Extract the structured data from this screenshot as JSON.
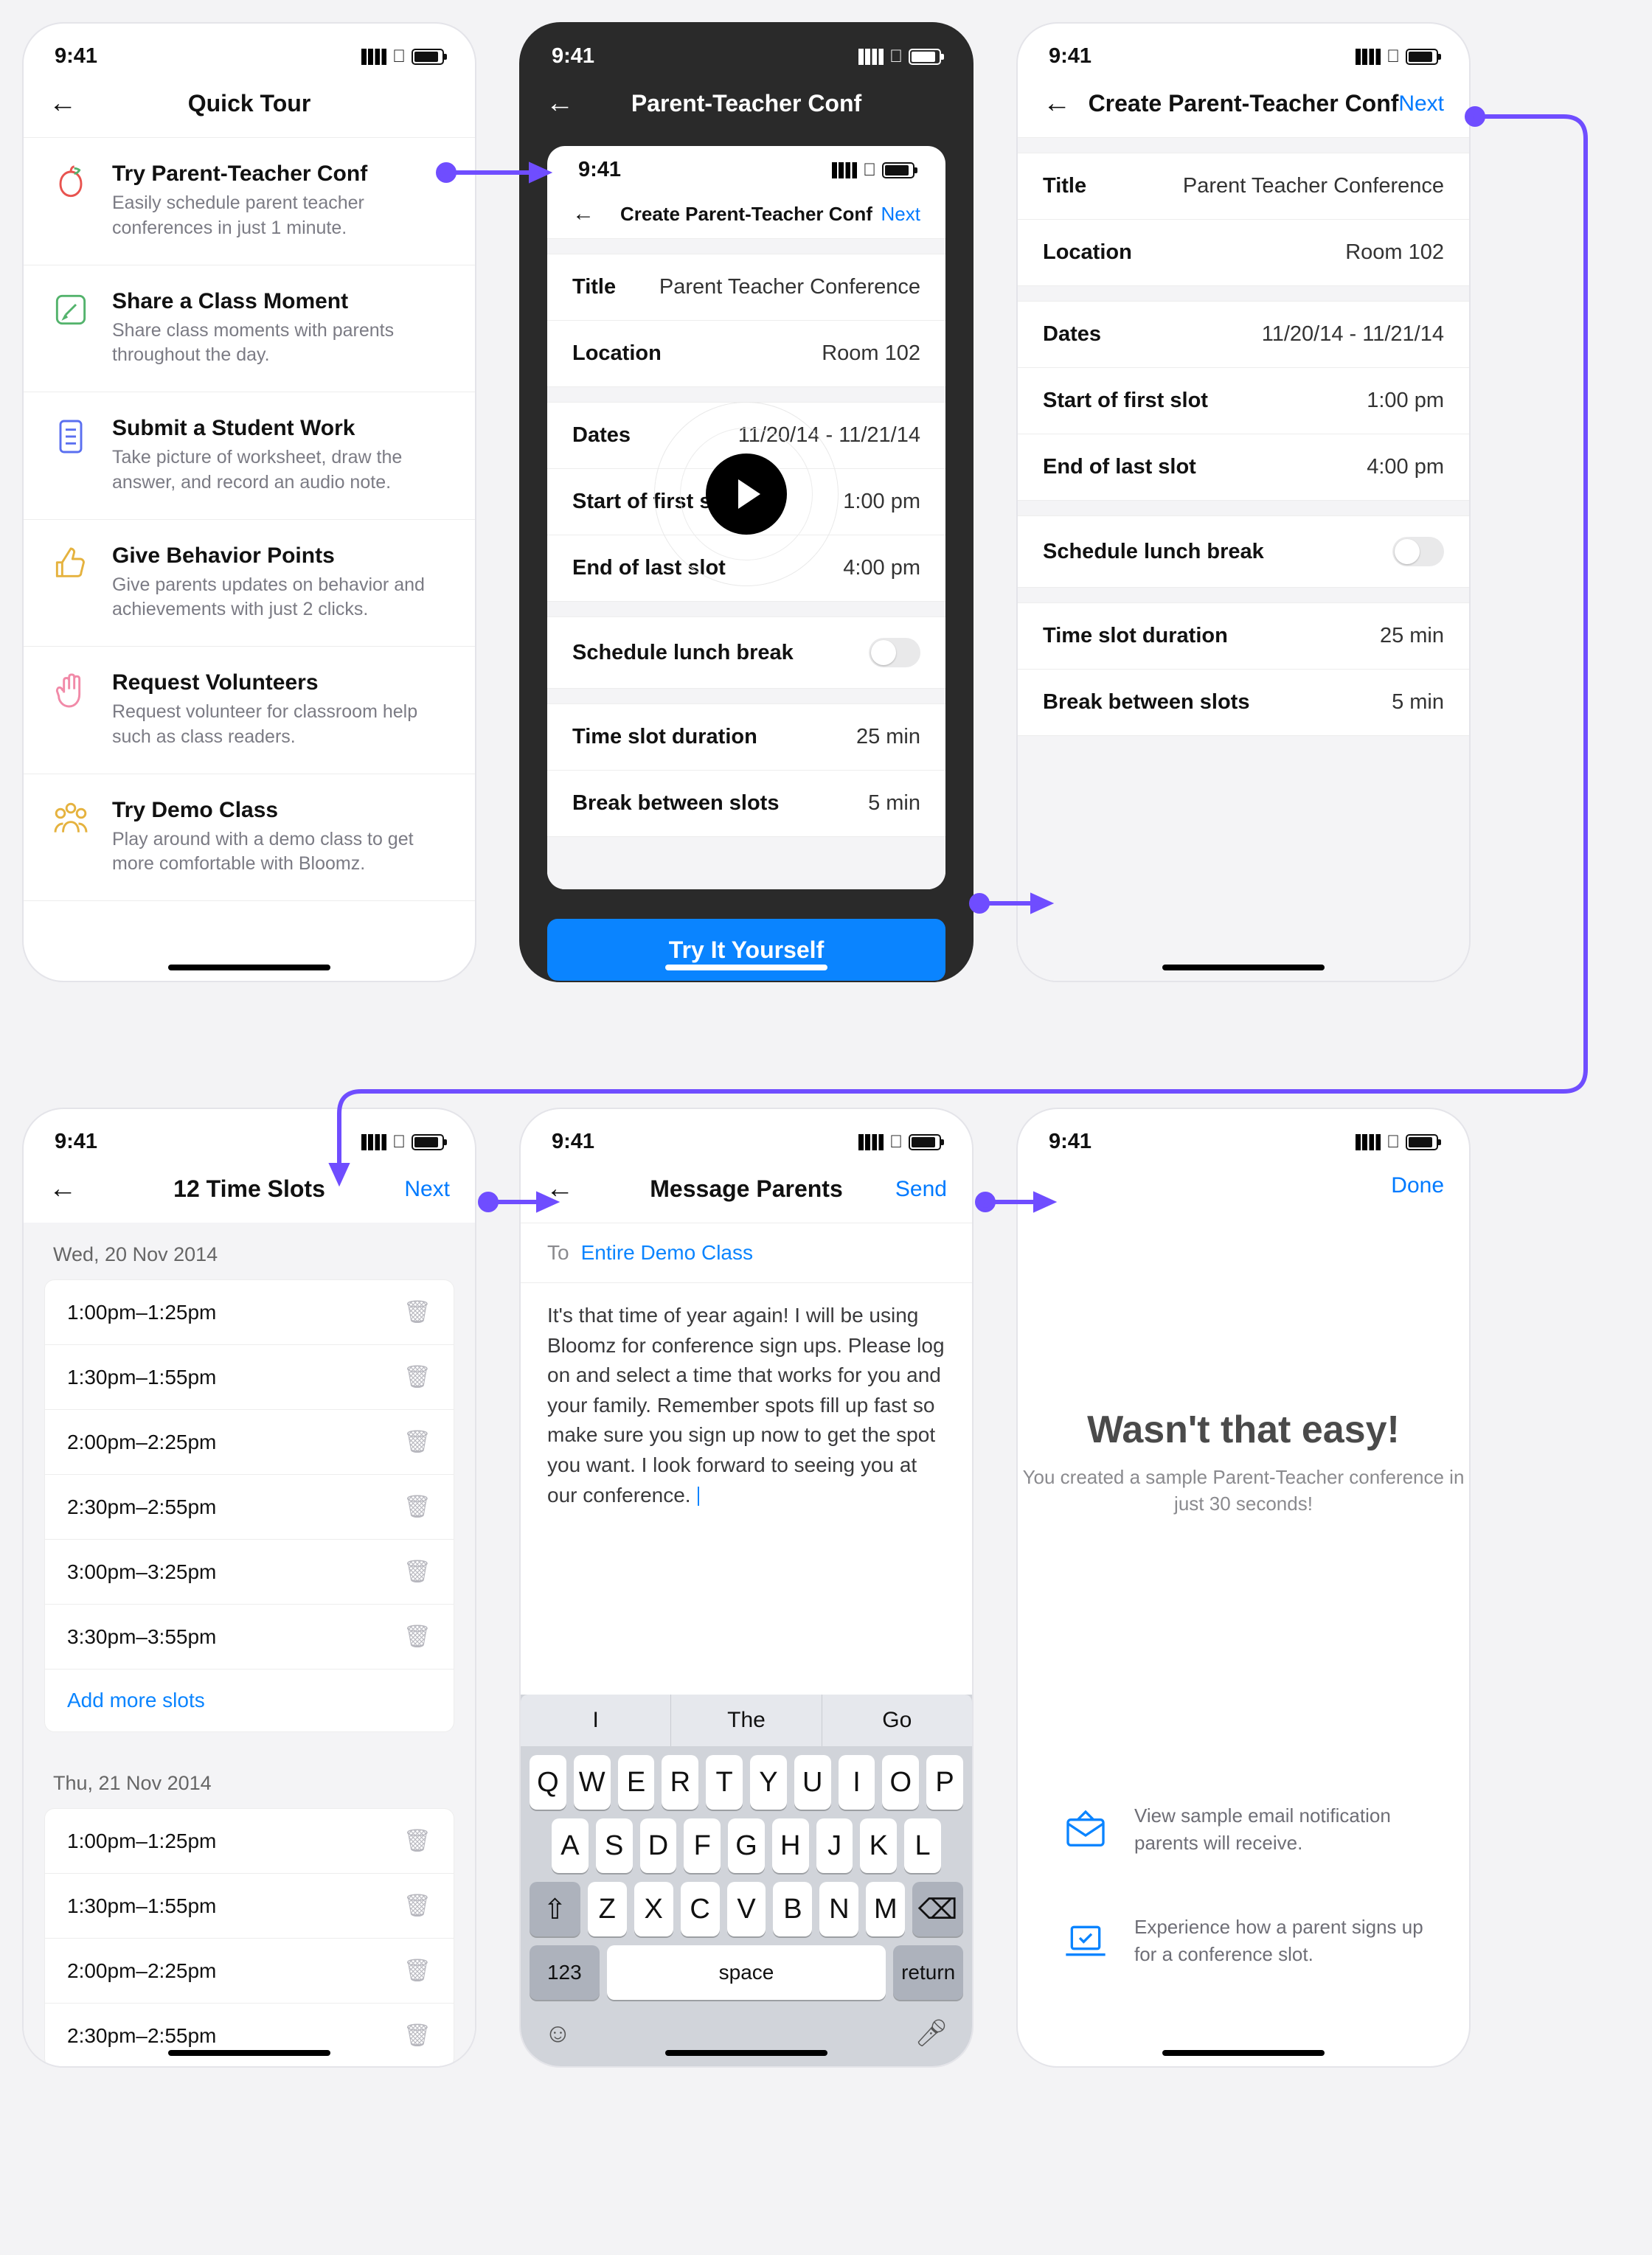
{
  "status_time": "9:41",
  "s1": {
    "title": "Quick Tour",
    "items": [
      {
        "icon": "apple",
        "title": "Try Parent-Teacher Conf",
        "sub": "Easily schedule parent teacher conferences in just 1 minute."
      },
      {
        "icon": "edit",
        "title": "Share a Class Moment",
        "sub": "Share class moments with parents throughout the day."
      },
      {
        "icon": "doc",
        "title": "Submit a Student Work",
        "sub": "Take picture of worksheet, draw the answer, and record an audio note."
      },
      {
        "icon": "thumb",
        "title": "Give Behavior Points",
        "sub": "Give parents updates on behavior and achievements with just 2 clicks."
      },
      {
        "icon": "hand",
        "title": "Request Volunteers",
        "sub": "Request volunteer for classroom help such as class readers."
      },
      {
        "icon": "group",
        "title": "Try Demo Class",
        "sub": "Play around with a demo class to get more comfortable with Bloomz."
      }
    ]
  },
  "s2": {
    "title": "Parent-Teacher Conf",
    "inner_title": "Create Parent-Teacher Conf",
    "next": "Next",
    "rows": {
      "title": {
        "l": "Title",
        "v": "Parent Teacher Conference"
      },
      "loc": {
        "l": "Location",
        "v": "Room 102"
      },
      "dates": {
        "l": "Dates",
        "v": "11/20/14 - 11/21/14"
      },
      "start": {
        "l": "Start of first slot",
        "v": "1:00 pm"
      },
      "end": {
        "l": "End of last slot",
        "v": "4:00 pm"
      },
      "lunch": {
        "l": "Schedule lunch break"
      },
      "dur": {
        "l": "Time slot duration",
        "v": "25 min"
      },
      "brk": {
        "l": "Break between slots",
        "v": "5 min"
      }
    },
    "try_btn": "Try It Yourself"
  },
  "s3": {
    "title": "Create Parent-Teacher Conf",
    "next": "Next"
  },
  "s4": {
    "title": "12 Time Slots",
    "next": "Next",
    "add_more": "Add more slots",
    "groups": [
      {
        "date": "Wed, 20 Nov 2014",
        "slots": [
          "1:00pm–1:25pm",
          "1:30pm–1:55pm",
          "2:00pm–2:25pm",
          "2:30pm–2:55pm",
          "3:00pm–3:25pm",
          "3:30pm–3:55pm"
        ]
      },
      {
        "date": "Thu, 21 Nov 2014",
        "slots": [
          "1:00pm–1:25pm",
          "1:30pm–1:55pm",
          "2:00pm–2:25pm",
          "2:30pm–2:55pm"
        ]
      }
    ]
  },
  "s5": {
    "title": "Message Parents",
    "send": "Send",
    "to_lbl": "To",
    "to_val": "Entire Demo Class",
    "body": "It's that time of year again! I will be using Bloomz for conference sign ups. Please log on and select a time that works for you and your family. Remember spots fill up fast so make sure you sign up now to get the spot you want. I look forward to seeing you at our conference. ",
    "sugg": [
      "I",
      "The",
      "Go"
    ],
    "keys": {
      "123": "123",
      "space": "space",
      "return": "return"
    }
  },
  "s6": {
    "done": "Done",
    "title": "Wasn't that easy!",
    "sub": "You created a sample Parent-Teacher conference in just 30 seconds!",
    "items": [
      {
        "t": "View sample email notification parents will receive."
      },
      {
        "t": "Experience how a parent signs up for a conference slot."
      }
    ]
  }
}
